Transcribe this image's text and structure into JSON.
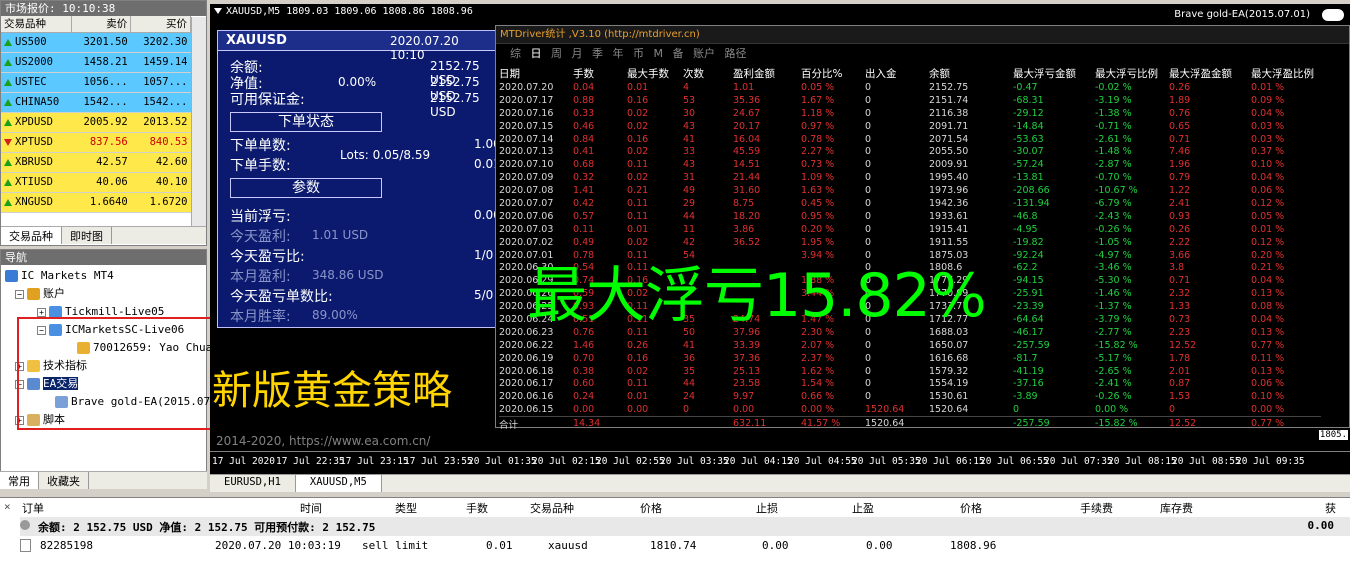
{
  "market_watch": {
    "title": "市场报价: 10:10:38",
    "cols": [
      "交易品种",
      "卖价",
      "买价"
    ],
    "rows": [
      {
        "sym": "US500",
        "bid": "3201.50",
        "ask": "3202.30",
        "dir": "up",
        "bg": "#5bc8ff"
      },
      {
        "sym": "US2000",
        "bid": "1458.21",
        "ask": "1459.14",
        "dir": "up",
        "bg": "#5bc8ff"
      },
      {
        "sym": "USTEC",
        "bid": "1056...",
        "ask": "1057...",
        "dir": "up",
        "bg": "#5bc8ff"
      },
      {
        "sym": "CHINA50",
        "bid": "1542...",
        "ask": "1542...",
        "dir": "up",
        "bg": "#5bc8ff"
      },
      {
        "sym": "XPDUSD",
        "bid": "2005.92",
        "ask": "2013.52",
        "dir": "up",
        "bg": "#ffe84a"
      },
      {
        "sym": "XPTUSD",
        "bid": "837.56",
        "ask": "840.53",
        "dir": "down",
        "bg": "#ffe84a"
      },
      {
        "sym": "XBRUSD",
        "bid": "42.57",
        "ask": "42.60",
        "dir": "up",
        "bg": "#ffe84a"
      },
      {
        "sym": "XTIUSD",
        "bid": "40.06",
        "ask": "40.10",
        "dir": "up",
        "bg": "#ffe84a"
      },
      {
        "sym": "XNGUSD",
        "bid": "1.6640",
        "ask": "1.6720",
        "dir": "up",
        "bg": "#ffe84a"
      }
    ],
    "tabs": [
      "交易品种",
      "即时图"
    ]
  },
  "navigator": {
    "title": "导航",
    "items": [
      "IC Markets MT4",
      "账户",
      "Tickmill-Live05",
      "ICMarketsSC-Live06",
      "70012659: Yao Chua",
      "技术指标",
      "EA交易",
      "Brave gold-EA(2015.07.",
      "脚本"
    ],
    "tabs": [
      "常用",
      "收藏夹"
    ]
  },
  "chart": {
    "title": "XAUUSD,M5  1809.03 1809.06 1808.86 1808.96",
    "ea_name": "Brave gold-EA(2015.07.01)",
    "panel": {
      "symbol": "XAUUSD",
      "time": "2020.07.20 10:10",
      "balance_l": "余额:",
      "balance_v": "2152.75 USD",
      "equity_l": "净值:",
      "equity_pct": "0.00%",
      "equity_v": "2152.75 USD",
      "margin_l": "可用保证金:",
      "margin_v": "2152.75 USD",
      "order_box": "下单状态",
      "orders_l": "下单单数:",
      "orders_v": "1.00",
      "lots_l": "下单手数:",
      "lots_mid": "Lots: 0.05/8.59",
      "lots_v": "0.01",
      "params_box": "参数",
      "float_l": "当前浮亏:",
      "float_v": "0.00",
      "today_l": "今天盈利:",
      "today_v": "1.01 USD",
      "todayp_l": "今天盈亏比:",
      "todayp_v": "1/0",
      "month_l": "本月盈利:",
      "month_v": "348.86 USD",
      "todaycnt_l": "今天盈亏单数比:",
      "todaycnt_v": "5/0",
      "rate_l": "本月胜率:",
      "rate_v": "89.00%"
    },
    "overlay": "新版黄金策略",
    "url": "2014-2020, https://www.ea.com.cn/",
    "xaxis": [
      "17 Jul 2020",
      "17 Jul 22:35",
      "17 Jul 23:15",
      "17 Jul 23:55",
      "20 Jul 01:35",
      "20 Jul 02:15",
      "20 Jul 02:55",
      "20 Jul 03:35",
      "20 Jul 04:15",
      "20 Jul 04:55",
      "20 Jul 05:35",
      "20 Jul 06:15",
      "20 Jul 06:55",
      "20 Jul 07:35",
      "20 Jul 08:15",
      "20 Jul 08:55",
      "20 Jul 09:35"
    ],
    "price_right": "1805.",
    "tabs": [
      "EURUSD,H1",
      "XAUUSD,M5"
    ]
  },
  "stats": {
    "title": "MTDriver统计 ,V3.10 (http://mtdriver.cn)",
    "menu": [
      "综",
      "日",
      "周",
      "月",
      "季",
      "年",
      "币",
      "M",
      "备",
      "账户",
      "路径"
    ],
    "headers": [
      "日期",
      "手数",
      "最大手数",
      "次数",
      "盈利金额",
      "百分比%",
      "出入金",
      "余额",
      "最大浮亏金额",
      "最大浮亏比例",
      "最大浮盈金额",
      "最大浮盈比例"
    ],
    "rows": [
      [
        "2020.07.20",
        "0.04",
        "0.01",
        "4",
        "1.01",
        "0.05 %",
        "0",
        "2152.75",
        "-0.47",
        "-0.02 %",
        "0.26",
        "0.01 %"
      ],
      [
        "2020.07.17",
        "0.88",
        "0.16",
        "53",
        "35.36",
        "1.67 %",
        "0",
        "2151.74",
        "-68.31",
        "-3.19 %",
        "1.89",
        "0.09 %"
      ],
      [
        "2020.07.16",
        "0.33",
        "0.02",
        "30",
        "24.67",
        "1.18 %",
        "0",
        "2116.38",
        "-29.12",
        "-1.38 %",
        "0.76",
        "0.04 %"
      ],
      [
        "2020.07.15",
        "0.46",
        "0.02",
        "43",
        "20.17",
        "0.97 %",
        "0",
        "2091.71",
        "-14.84",
        "-0.71 %",
        "0.65",
        "0.03 %"
      ],
      [
        "2020.07.14",
        "0.84",
        "0.16",
        "41",
        "16.04",
        "0.78 %",
        "0",
        "2071.54",
        "-53.63",
        "-2.61 %",
        "0.71",
        "0.03 %"
      ],
      [
        "2020.07.13",
        "0.41",
        "0.02",
        "33",
        "45.59",
        "2.27 %",
        "0",
        "2055.50",
        "-30.07",
        "-1.48 %",
        "7.46",
        "0.37 %"
      ],
      [
        "2020.07.10",
        "0.68",
        "0.11",
        "43",
        "14.51",
        "0.73 %",
        "0",
        "2009.91",
        "-57.24",
        "-2.87 %",
        "1.96",
        "0.10 %"
      ],
      [
        "2020.07.09",
        "0.32",
        "0.02",
        "31",
        "21.44",
        "1.09 %",
        "0",
        "1995.40",
        "-13.81",
        "-0.70 %",
        "0.79",
        "0.04 %"
      ],
      [
        "2020.07.08",
        "1.41",
        "0.21",
        "49",
        "31.60",
        "1.63 %",
        "0",
        "1973.96",
        "-208.66",
        "-10.67 %",
        "1.22",
        "0.06 %"
      ],
      [
        "2020.07.07",
        "0.42",
        "0.11",
        "29",
        "8.75",
        "0.45 %",
        "0",
        "1942.36",
        "-131.94",
        "-6.79 %",
        "2.41",
        "0.12 %"
      ],
      [
        "2020.07.06",
        "0.57",
        "0.11",
        "44",
        "18.20",
        "0.95 %",
        "0",
        "1933.61",
        "-46.8",
        "-2.43 %",
        "0.93",
        "0.05 %"
      ],
      [
        "2020.07.03",
        "0.11",
        "0.01",
        "11",
        "3.86",
        "0.20 %",
        "0",
        "1915.41",
        "-4.95",
        "-0.26 %",
        "0.26",
        "0.01 %"
      ],
      [
        "2020.07.02",
        "0.49",
        "0.02",
        "42",
        "36.52",
        "1.95 %",
        "0",
        "1911.55",
        "-19.82",
        "-1.05 %",
        "2.22",
        "0.12 %"
      ],
      [
        "2020.07.01",
        "0.78",
        "0.11",
        "54",
        "",
        "3.94 %",
        "0",
        "1875.03",
        "-92.24",
        "-4.97 %",
        "3.66",
        "0.20 %"
      ],
      [
        "2020.06.30",
        "0.54",
        "0.11",
        "",
        "",
        "",
        "0",
        "1808.6",
        "-62.2",
        "-3.46 %",
        "3.8",
        "0.21 %"
      ],
      [
        "2020.06.29",
        "0.74",
        "0.16",
        "",
        "",
        "1.88 %",
        "0",
        "1777.29",
        "-94.15",
        "-5.30 %",
        "0.71",
        "0.04 %"
      ],
      [
        "2020.06.26",
        "0.59",
        "0.02",
        "",
        "",
        "3.44 %",
        "0",
        "1770.09",
        "-25.91",
        "-1.46 %",
        "2.32",
        "0.13 %"
      ],
      [
        "2020.06.25",
        "0.93",
        "0.11",
        "",
        "",
        "",
        "0",
        "1733.77",
        "-23.39",
        "-1.37 %",
        "1.33",
        "0.08 %"
      ],
      [
        "2020.06.24",
        "0.51",
        "0.11",
        "35",
        "24.74",
        "1.47 %",
        "0",
        "1712.77",
        "-64.64",
        "-3.79 %",
        "0.73",
        "0.04 %"
      ],
      [
        "2020.06.23",
        "0.76",
        "0.11",
        "50",
        "37.96",
        "2.30 %",
        "0",
        "1688.03",
        "-46.17",
        "-2.77 %",
        "2.23",
        "0.13 %"
      ],
      [
        "2020.06.22",
        "1.46",
        "0.26",
        "41",
        "33.39",
        "2.07 %",
        "0",
        "1650.07",
        "-257.59",
        "-15.82 %",
        "12.52",
        "0.77 %"
      ],
      [
        "2020.06.19",
        "0.70",
        "0.16",
        "36",
        "37.36",
        "2.37 %",
        "0",
        "1616.68",
        "-81.7",
        "-5.17 %",
        "1.78",
        "0.11 %"
      ],
      [
        "2020.06.18",
        "0.38",
        "0.02",
        "35",
        "25.13",
        "1.62 %",
        "0",
        "1579.32",
        "-41.19",
        "-2.65 %",
        "2.01",
        "0.13 %"
      ],
      [
        "2020.06.17",
        "0.60",
        "0.11",
        "44",
        "23.58",
        "1.54 %",
        "0",
        "1554.19",
        "-37.16",
        "-2.41 %",
        "0.87",
        "0.06 %"
      ],
      [
        "2020.06.16",
        "0.24",
        "0.01",
        "24",
        "9.97",
        "0.66 %",
        "0",
        "1530.61",
        "-3.89",
        "-0.26 %",
        "1.53",
        "0.10 %"
      ],
      [
        "2020.06.15",
        "0.00",
        "0.00",
        "0",
        "0.00",
        "0.00 %",
        "1520.64",
        "1520.64",
        "0",
        "0.00 %",
        "0",
        "0.00 %"
      ]
    ],
    "total": [
      "合计",
      "14.34",
      "",
      "",
      "632.11",
      "41.57 %",
      "1520.64",
      "",
      "-257.59",
      "-15.82 %",
      "12.52",
      "0.77 %"
    ],
    "big": "最大浮亏15.82%"
  },
  "terminal": {
    "headers": [
      "订单",
      "时间",
      "类型",
      "手数",
      "交易品种",
      "价格",
      "止损",
      "止盈",
      "价格",
      "手续费",
      "库存费",
      "获"
    ],
    "summary": "余额: 2 152.75 USD  净值: 2 152.75  可用预付款: 2 152.75",
    "summary_right": "0.00",
    "order": [
      "82285198",
      "2020.07.20 10:03:19",
      "sell limit",
      "0.01",
      "xauusd",
      "1810.74",
      "0.00",
      "0.00",
      "1808.96"
    ]
  }
}
